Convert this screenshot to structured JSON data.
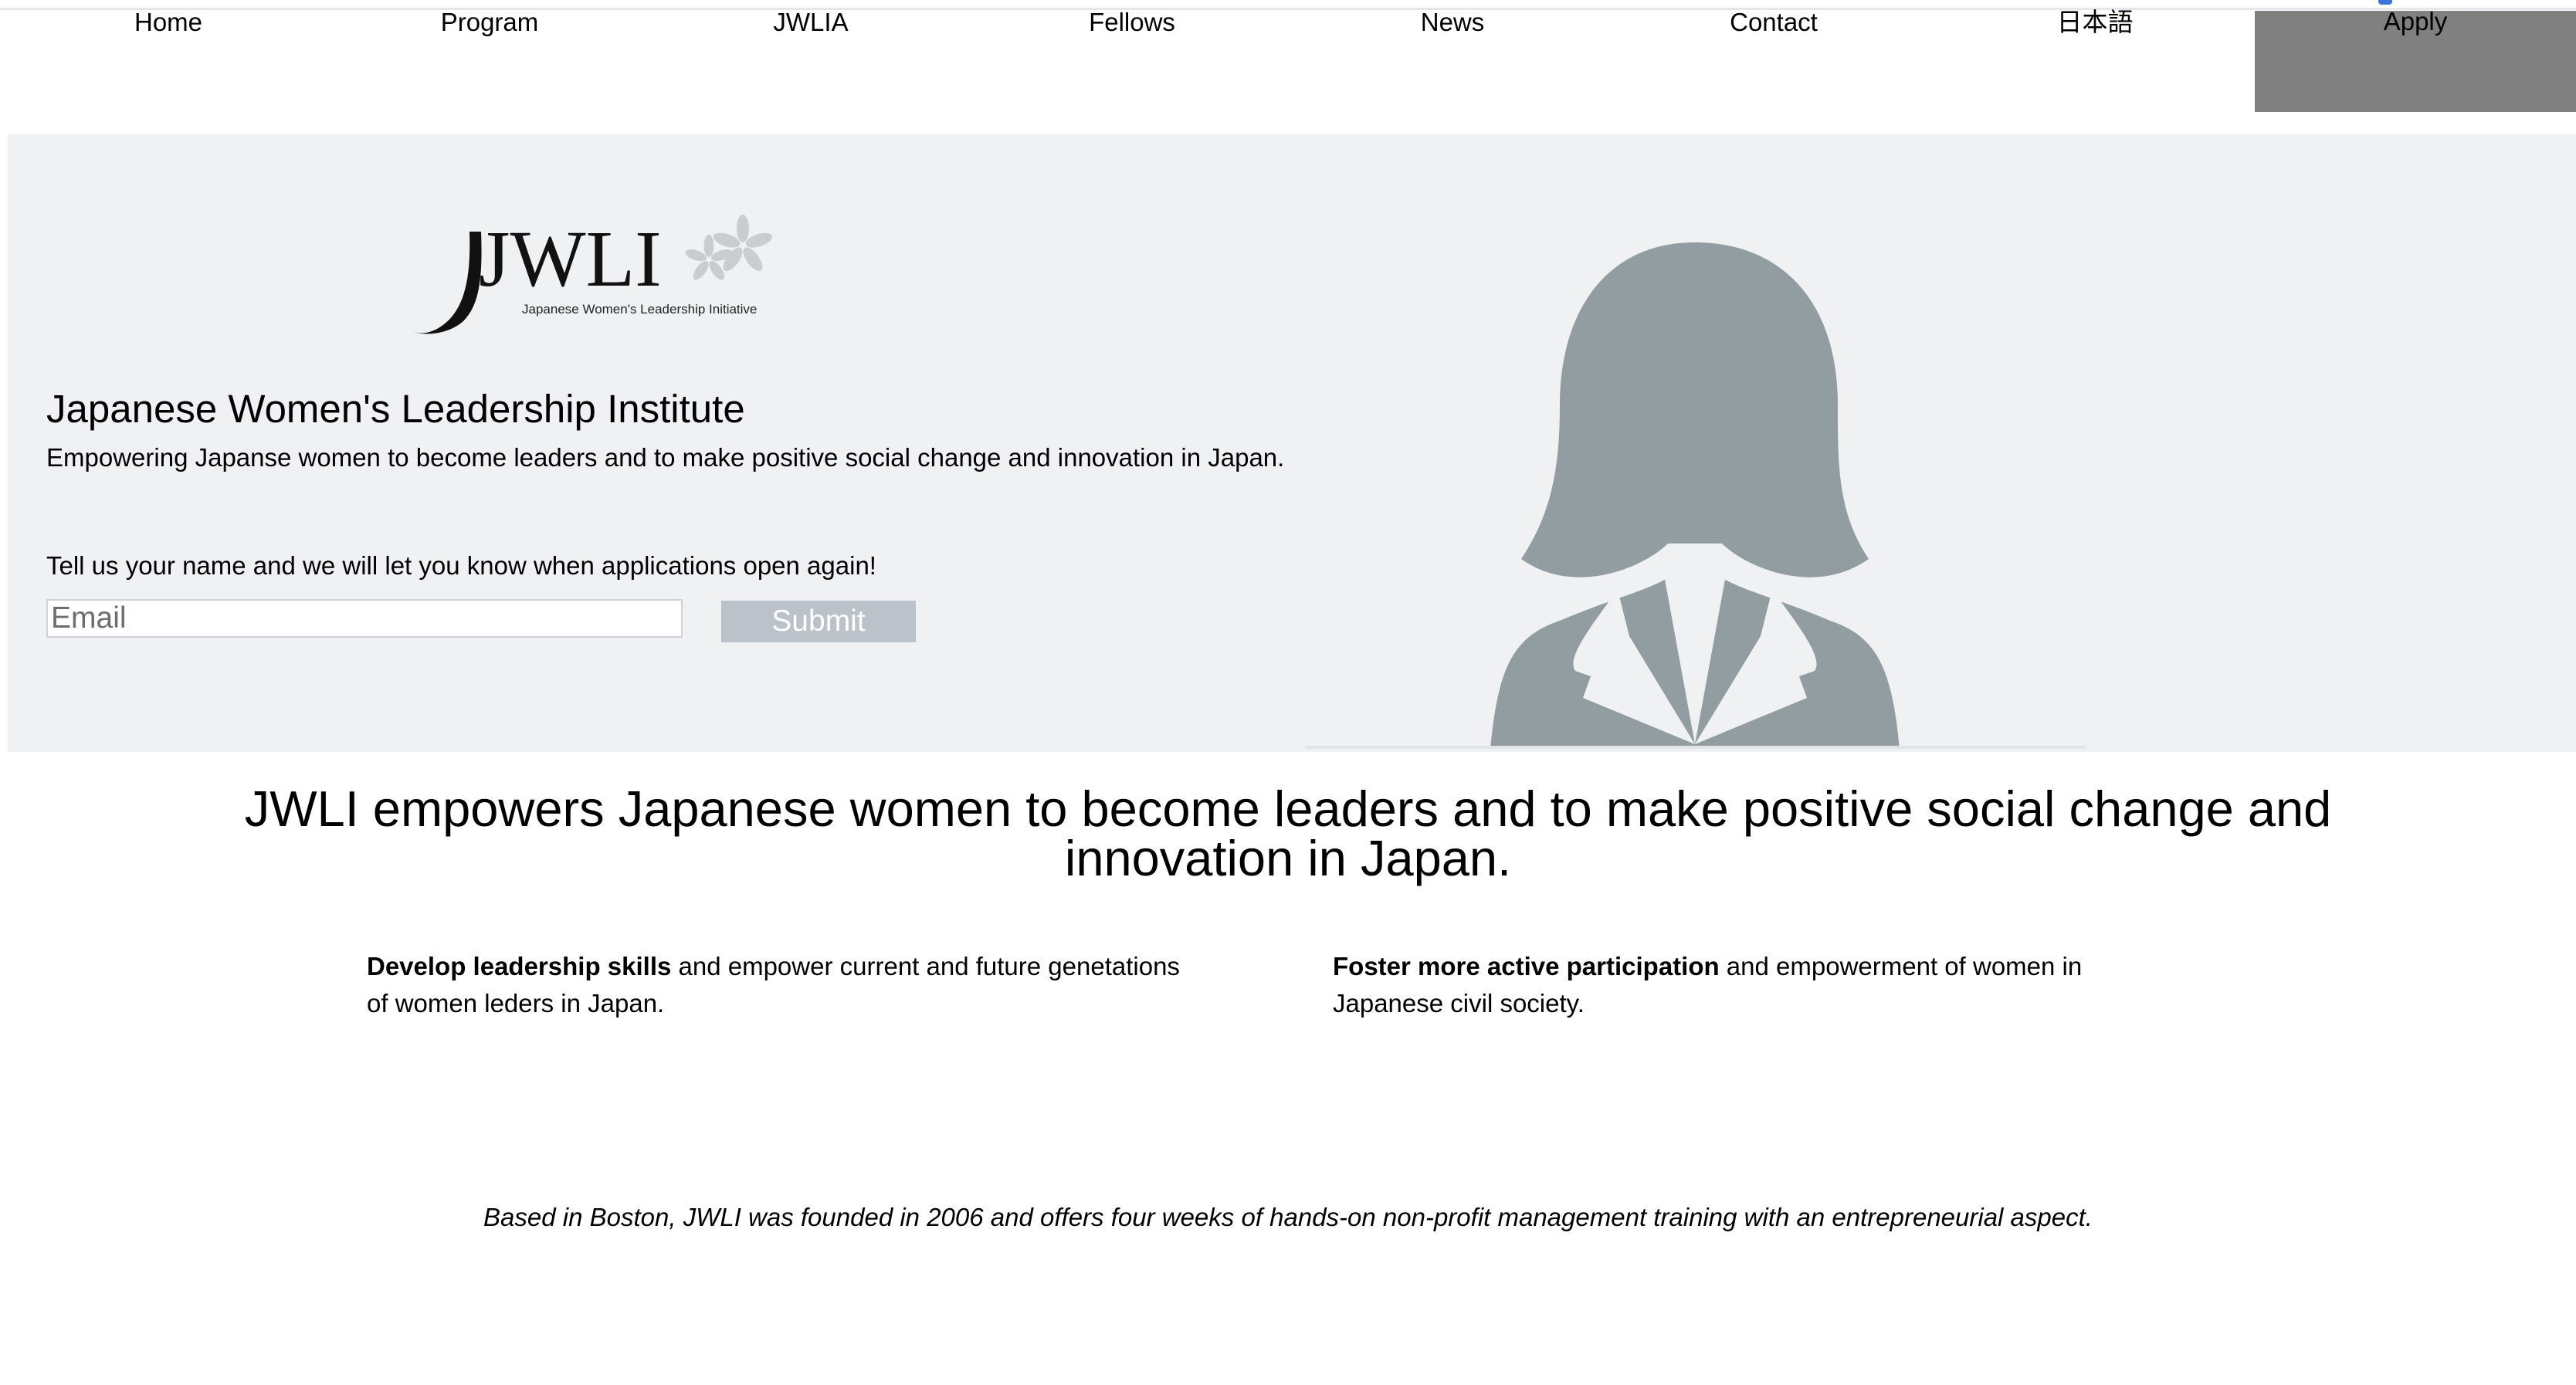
{
  "nav": {
    "items": [
      {
        "label": "Home"
      },
      {
        "label": "Program"
      },
      {
        "label": "JWLIA"
      },
      {
        "label": "Fellows"
      },
      {
        "label": "News"
      },
      {
        "label": "Contact"
      },
      {
        "label": "日本語"
      },
      {
        "label": "Apply"
      }
    ]
  },
  "hero": {
    "logo": {
      "wordmark": "JWLI",
      "tagline": "Japanese Women's Leadership Initiative"
    },
    "title": "Japanese Women's Leadership Institute",
    "subtitle": "Empowering Japanse women to become leaders and to make positive social change and innovation in Japan.",
    "prompt": "Tell us your name and we will let you know when applications open again!",
    "email_placeholder": "Email",
    "submit_label": "Submit",
    "colors": {
      "hero_bg": "#f0f1f3",
      "avatar": "#929da1",
      "submit_bg": "#bcc2ca",
      "apply_bg": "#808080"
    }
  },
  "main": {
    "headline": "JWLI empowers Japanese women to become leaders and to make positive social change and innovation in Japan.",
    "columns": [
      {
        "bold": "Develop leadership skills",
        "text": " and empower current and future genetations of women leders in Japan."
      },
      {
        "bold": "Foster more active participation",
        "text": " and empowerment of women in Japanese civil society."
      }
    ],
    "footer_note": "Based in Boston, JWLI was founded in 2006 and offers four weeks of hands-on non-profit management training with an entrepreneurial aspect."
  }
}
